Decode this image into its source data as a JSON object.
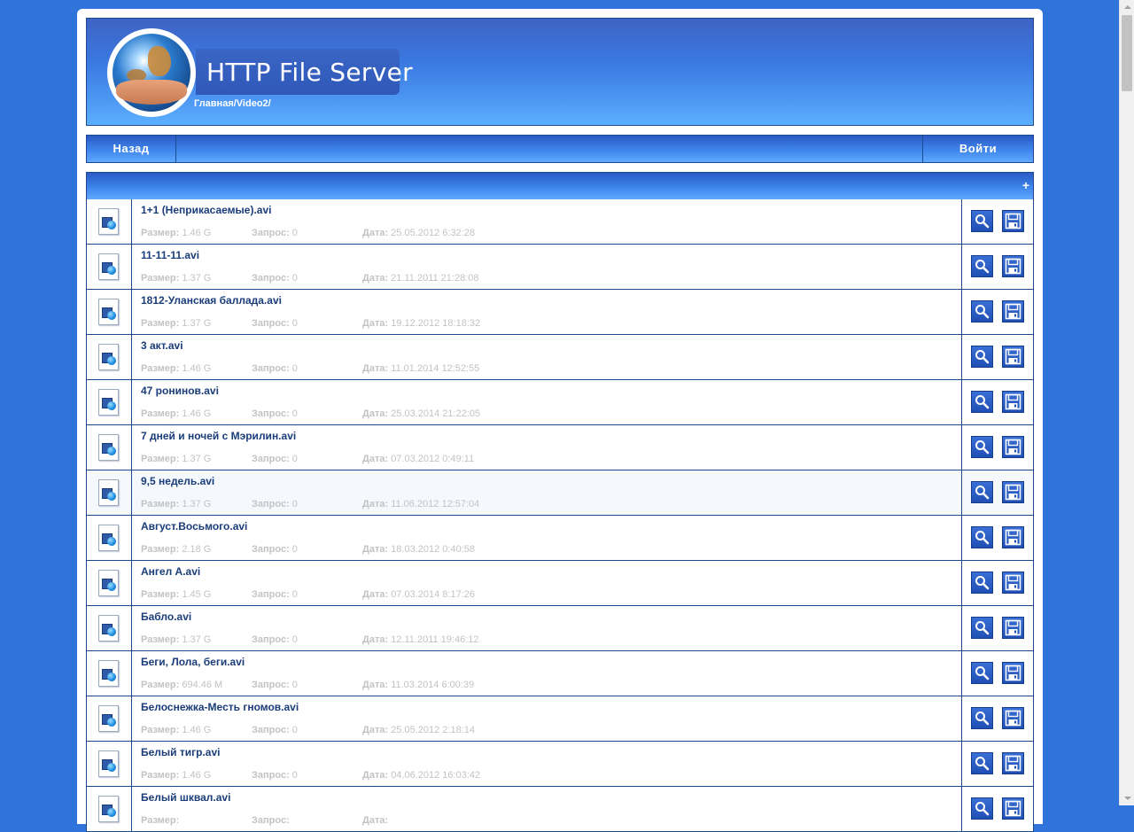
{
  "header": {
    "title": "HTTP File Server",
    "breadcrumb": "Главная/Video2/"
  },
  "nav": {
    "back_label": "Назад",
    "login_label": "Войти"
  },
  "list": {
    "expand_symbol": "+",
    "labels": {
      "size": "Размер:",
      "requests": "Запрос:",
      "date": "Дата:"
    },
    "files": [
      {
        "name": "1+1 (Неприкасаемые).avi",
        "size": "1.46 G",
        "requests": "0",
        "date": "25.05.2012 6:32:28"
      },
      {
        "name": "11-11-11.avi",
        "size": "1.37 G",
        "requests": "0",
        "date": "21.11.2011 21:28:08"
      },
      {
        "name": "1812-Уланская баллада.avi",
        "size": "1.37 G",
        "requests": "0",
        "date": "19.12.2012 18:18:32"
      },
      {
        "name": "3 акт.avi",
        "size": "1.46 G",
        "requests": "0",
        "date": "11.01.2014 12:52:55"
      },
      {
        "name": "47 ронинов.avi",
        "size": "1.46 G",
        "requests": "0",
        "date": "25.03.2014 21:22:05"
      },
      {
        "name": "7 дней и ночей с Мэрилин.avi",
        "size": "1.37 G",
        "requests": "0",
        "date": "07.03.2012 0:49:11"
      },
      {
        "name": "9,5 недель.avi",
        "size": "1.37 G",
        "requests": "0",
        "date": "11.06.2012 12:57:04",
        "highlighted": true
      },
      {
        "name": "Август.Восьмого.avi",
        "size": "2.18 G",
        "requests": "0",
        "date": "18.03.2012 0:40:58"
      },
      {
        "name": "Ангел А.avi",
        "size": "1.45 G",
        "requests": "0",
        "date": "07.03.2014 8:17:26"
      },
      {
        "name": "Бабло.avi",
        "size": "1.37 G",
        "requests": "0",
        "date": "12.11.2011 19:46:12"
      },
      {
        "name": "Беги, Лола, беги.avi",
        "size": "694.46 M",
        "requests": "0",
        "date": "11.03.2014 6:00:39"
      },
      {
        "name": "Белоснежка-Месть гномов.avi",
        "size": "1.46 G",
        "requests": "0",
        "date": "25.05.2012 2:18:14"
      },
      {
        "name": "Белый тигр.avi",
        "size": "1.46 G",
        "requests": "0",
        "date": "04.06.2012 16:03:42"
      },
      {
        "name": "Белый шквал.avi",
        "size": "",
        "requests": "",
        "date": ""
      }
    ]
  },
  "colors": {
    "page_bg": "#2f73db",
    "accent": "#3f86ec",
    "border": "#1d4a8c",
    "link": "#1a3d7a",
    "meta_text": "#c3c3c3"
  },
  "icons": {
    "file": "video-file-icon",
    "preview": "magnifier-icon",
    "download": "floppy-disk-icon"
  }
}
